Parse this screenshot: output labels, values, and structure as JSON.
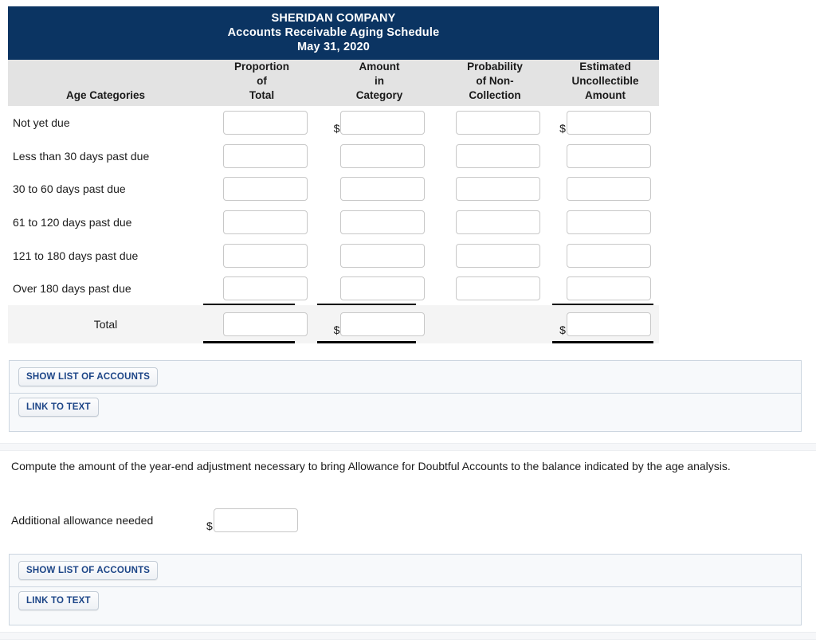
{
  "schedule": {
    "title_lines": [
      "SHERIDAN COMPANY",
      "Accounts Receivable Aging Schedule",
      "May 31, 2020"
    ],
    "company": "SHERIDAN COMPANY",
    "subtitle": "Accounts Receivable Aging Schedule",
    "date": "May 31, 2020",
    "columns": [
      {
        "id": "age_categories",
        "lines": [
          "",
          "",
          "Age Categories"
        ]
      },
      {
        "id": "proportion_of_total",
        "lines": [
          "Proportion",
          "of",
          "Total"
        ]
      },
      {
        "id": "amount_in_category",
        "lines": [
          "Amount",
          "in",
          "Category"
        ]
      },
      {
        "id": "probability_of_non_collection",
        "lines": [
          "Probability",
          "of Non-",
          "Collection"
        ]
      },
      {
        "id": "estimated_uncollectible_amount",
        "lines": [
          "Estimated",
          "Uncollectible",
          "Amount"
        ]
      }
    ],
    "rows": [
      {
        "label": "Not yet due",
        "c1": "",
        "c2": "",
        "c3": "",
        "c4": "",
        "c2_prefix": "$",
        "c4_prefix": "$"
      },
      {
        "label": "Less than 30 days past due",
        "c1": "",
        "c2": "",
        "c3": "",
        "c4": "",
        "c2_prefix": "",
        "c4_prefix": ""
      },
      {
        "label": "30 to 60 days past due",
        "c1": "",
        "c2": "",
        "c3": "",
        "c4": "",
        "c2_prefix": "",
        "c4_prefix": ""
      },
      {
        "label": "61 to 120 days past due",
        "c1": "",
        "c2": "",
        "c3": "",
        "c4": "",
        "c2_prefix": "",
        "c4_prefix": ""
      },
      {
        "label": "121 to 180 days past due",
        "c1": "",
        "c2": "",
        "c3": "",
        "c4": "",
        "c2_prefix": "",
        "c4_prefix": ""
      },
      {
        "label": "Over 180 days past due",
        "c1": "",
        "c2": "",
        "c3": "",
        "c4": "",
        "c2_prefix": "",
        "c4_prefix": ""
      }
    ],
    "total_row": {
      "label": "Total",
      "c1": "",
      "c2": "",
      "c2_prefix": "$",
      "c3_has_input": false,
      "c4": "",
      "c4_prefix": "$"
    },
    "header_bg": "#0b3462",
    "subheader_bg": "#e3e3e3",
    "total_bg": "#f4f4f4"
  },
  "panel1": {
    "show_list_label": "SHOW LIST OF ACCOUNTS",
    "link_to_text_label": "LINK TO TEXT"
  },
  "question2": {
    "prompt": "Compute the amount of the year-end adjustment necessary to bring Allowance for Doubtful Accounts to the balance indicated by the age analysis.",
    "label": "Additional allowance needed",
    "prefix": "$",
    "value": ""
  },
  "panel2": {
    "show_list_label": "SHOW LIST OF ACCOUNTS",
    "link_to_text_label": "LINK TO TEXT"
  },
  "colors": {
    "header_blue": "#0b3462",
    "button_text": "#1c4587",
    "panel_border": "#ccd6e0"
  }
}
